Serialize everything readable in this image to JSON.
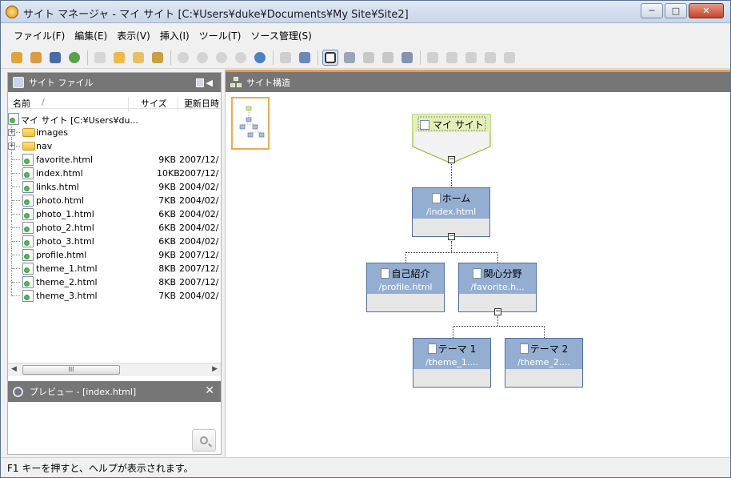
{
  "window": {
    "title": "サイト マネージャ - マイ サイト [C:¥Users¥duke¥Documents¥My Site¥Site2]",
    "minimize": "─",
    "maximize": "□",
    "close": "✕"
  },
  "menu": [
    "ファイル(F)",
    "編集(E)",
    "表示(V)",
    "挿入(I)",
    "ツール(T)",
    "ソース管理(S)"
  ],
  "left_pane": {
    "title": "サイト ファイル",
    "columns": {
      "name": "名前",
      "sort_mark": "/",
      "size": "サイズ",
      "modified": "更新日時"
    },
    "root": "マイ サイト [C:¥Users¥du...",
    "folders": [
      {
        "name": "images",
        "expander": "+"
      },
      {
        "name": "nav",
        "expander": "+"
      }
    ],
    "files": [
      {
        "name": "favorite.html",
        "size": "9KB",
        "date": "2007/12/"
      },
      {
        "name": "index.html",
        "size": "10KB",
        "date": "2007/12/"
      },
      {
        "name": "links.html",
        "size": "9KB",
        "date": "2004/02/"
      },
      {
        "name": "photo.html",
        "size": "7KB",
        "date": "2004/02/"
      },
      {
        "name": "photo_1.html",
        "size": "6KB",
        "date": "2004/02/"
      },
      {
        "name": "photo_2.html",
        "size": "6KB",
        "date": "2004/02/"
      },
      {
        "name": "photo_3.html",
        "size": "6KB",
        "date": "2004/02/"
      },
      {
        "name": "profile.html",
        "size": "9KB",
        "date": "2007/12/"
      },
      {
        "name": "theme_1.html",
        "size": "8KB",
        "date": "2007/12/"
      },
      {
        "name": "theme_2.html",
        "size": "8KB",
        "date": "2007/12/"
      },
      {
        "name": "theme_3.html",
        "size": "7KB",
        "date": "2004/02/"
      }
    ],
    "scroll_left": "◀",
    "scroll_right": "▶",
    "scroll_grip": "III"
  },
  "preview": {
    "title": "プレビュー - [index.html]",
    "close": "✕"
  },
  "right_pane": {
    "title": "サイト構造",
    "nodes": {
      "root": {
        "label": "マイ サイト"
      },
      "home": {
        "label": "ホーム",
        "path": "/index.html"
      },
      "profile": {
        "label": "自己紹介",
        "path": "/profile.html"
      },
      "favorite": {
        "label": "関心分野",
        "path": "/favorite.h..."
      },
      "theme1": {
        "label": "テーマ 1",
        "path": "/theme_1...."
      },
      "theme2": {
        "label": "テーマ 2",
        "path": "/theme_2...."
      }
    },
    "collapse_symbol": "−"
  },
  "status": "F1 キーを押すと、ヘルプが表示されます。",
  "colors": {
    "pane_header": "#767676",
    "accent_orange": "#f29a3c",
    "node_blue": "#94aed2",
    "root_green": "#e3efb8"
  },
  "toolbar_icons": [
    "new-site-icon",
    "open-site-icon",
    "save-icon",
    "publish-icon",
    "new-folder-icon",
    "new-page-icon",
    "open-folder-icon",
    "wizard-icon",
    "back-icon",
    "stop-icon",
    "refresh-icon",
    "search-icon",
    "sync-icon",
    "print-icon",
    "preview-icon",
    "site-structure-icon",
    "tree-view-icon",
    "flow-view-icon",
    "hierarchy-icon",
    "arrange-icon",
    "copy-icon",
    "paste-icon",
    "duplicate-icon",
    "move-icon",
    "delete-icon"
  ]
}
